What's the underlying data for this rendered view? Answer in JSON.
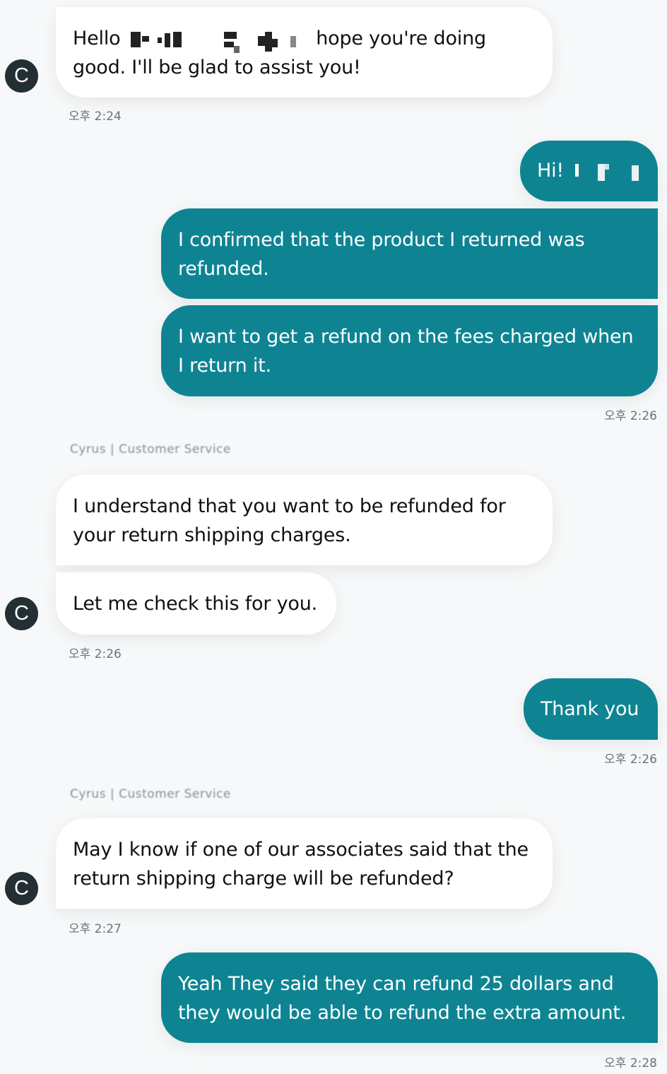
{
  "messages": {
    "m1": {
      "prefix": "Hello",
      "text": "hope you're doing",
      "text2": "good. I'll be glad to assist you!",
      "time": "오후 2:24",
      "avatar": "C"
    },
    "m2": {
      "text": "Hi!",
      "time": ""
    },
    "m3": {
      "text": "I confirmed that the product I returned was refunded."
    },
    "m4": {
      "text": "I want to get a refund on the fees charged when I return it.",
      "time": "오후 2:26"
    },
    "s1": {
      "sender": "Cyrus | Customer Service"
    },
    "m5": {
      "text": "I understand that you want to be refunded for your return shipping charges."
    },
    "m6": {
      "text": "Let me check this for you.",
      "time": "오후 2:26",
      "avatar": "C"
    },
    "m7": {
      "text": "Thank you",
      "time": "오후 2:26"
    },
    "s2": {
      "sender": "Cyrus | Customer Service"
    },
    "m8": {
      "text": "May I know if one of our associates said that the return shipping charge will be refunded?",
      "time": "오후 2:27",
      "avatar": "C"
    },
    "m9": {
      "text": "Yeah They said they can refund 25 dollars and they would be able to refund the extra amount.",
      "time": "오후 2:28"
    }
  },
  "colors": {
    "user_bubble": "#0e8493",
    "agent_bubble": "#ffffff",
    "avatar": "#232f33",
    "background": "#f6f8f9"
  }
}
